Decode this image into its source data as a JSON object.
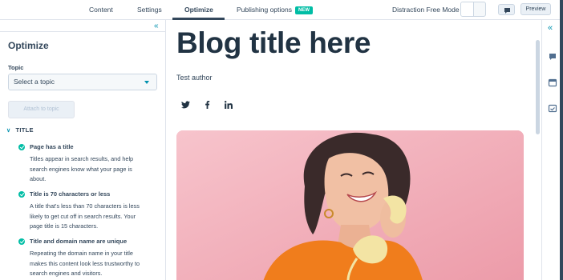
{
  "tabs": [
    {
      "label": "Content"
    },
    {
      "label": "Settings"
    },
    {
      "label": "Optimize"
    },
    {
      "label": "Publishing options"
    }
  ],
  "publishing_badge": "NEW",
  "distraction_free_label": "Distraction Free Mode",
  "preview_label": "Preview",
  "sidebar": {
    "title": "Optimize",
    "topic_label": "Topic",
    "topic_placeholder": "Select a topic",
    "attach_label": "Attach to topic",
    "section_title": "TITLE",
    "items": [
      {
        "title": "Page has a title",
        "lines": [
          "Titles appear in search results, and help",
          "search engines know what your page is",
          "about."
        ]
      },
      {
        "title": "Title is 70 characters or less",
        "lines": [
          "A title that's less than 70 characters is less",
          "likely to get cut off in search results. Your",
          "page title is 15 characters."
        ]
      },
      {
        "title": "Title and domain name are unique",
        "lines": [
          "Repeating the domain name in your title",
          "makes this content look less trustworthy to",
          "search engines and visitors."
        ]
      }
    ]
  },
  "editor": {
    "blog_title": "Blog title here",
    "author": "Test author",
    "social": [
      "twitter-icon",
      "facebook-icon",
      "linkedin-icon"
    ]
  },
  "rail_icons": [
    "collapse-right-icon",
    "comment-icon",
    "calendar-icon",
    "calendar-check-icon"
  ],
  "colors": {
    "brand_dark": "#213343",
    "accent_teal": "#00bda5",
    "link": "#0091ae",
    "hero_bg": "#f3b8c1"
  }
}
